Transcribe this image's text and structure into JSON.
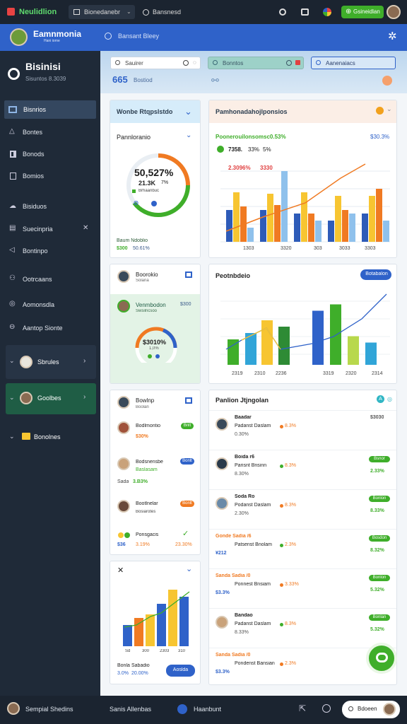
{
  "topbar": {
    "app_name": "Neulidlion",
    "tab1": "Bionedanebr",
    "tab2": "Bansnesd",
    "action_button": "Gsineidlan"
  },
  "header": {
    "brand": "Eamnmonia",
    "brand_sub": "Hani iorne",
    "search_placeholder": "Bansant Bleey"
  },
  "sidebar": {
    "title": "Bisinisi",
    "subtitle": "Sisuntos  8.3039",
    "items": [
      {
        "label": "Bisnrios"
      },
      {
        "label": "Bontes"
      },
      {
        "label": "Bonods"
      },
      {
        "label": "Bomios"
      },
      {
        "label": "Bisiduos"
      },
      {
        "label": "Suecinpria"
      },
      {
        "label": "Bontinpo"
      },
      {
        "label": "Ootrcaans"
      },
      {
        "label": "Aomonsdla"
      },
      {
        "label": "Aantop Sionte"
      }
    ],
    "profiles": [
      {
        "label": "Sbrules"
      },
      {
        "label": "Goolbes"
      },
      {
        "label": "Bonolnes"
      }
    ]
  },
  "filters": {
    "f1": "Sauirer",
    "f2": "Bonntos",
    "f3": "Aanenaiacs",
    "stat1": "665",
    "stat2": "Bostiod"
  },
  "cards": {
    "donut": {
      "title": "Wonbe Rtqpslstdo",
      "subtitle": "Pannloranio",
      "value": "50,527%",
      "sub1": "21.3K",
      "sub1_suffix": "7%",
      "sub2": "Brhaanbuc",
      "legend_label": "Baum Ndoblio",
      "legend_v1": "$300",
      "legend_v2": "50.61%"
    },
    "bar_main": {
      "title": "Pamhonadahojlponsios",
      "subtitle": "Poonerouilonsomsc0.53%",
      "right_value": "$30.3%",
      "l1a": "7358.",
      "l1b": "33%",
      "l1c": "5%",
      "l2a": "2.3096%",
      "l2b": "3330"
    },
    "profile_card": {
      "name": "Boorokio",
      "sub": "Solana",
      "name2": "Venmbodon",
      "sub2": "Swsilncsoo",
      "value": "$300",
      "gauge_value": "$3010%",
      "gauge_sub": "1,0%"
    },
    "bar_second": {
      "title": "Peotnbdeio",
      "button": "Botabalon"
    },
    "contacts": {
      "title": "Bowlnp",
      "subtitle": "Boolan",
      "rows": [
        {
          "name": "Bodlmontio",
          "value": "$30%",
          "tag": "Bnlt"
        },
        {
          "name": "Bodsnensbe",
          "value": "Baslasam",
          "tag": "Bonlt"
        },
        {
          "name": "Bootlnelar",
          "value": "Bosiarotes",
          "tag": "Bonlt"
        }
      ],
      "footer_a": "Ponsgacis",
      "footer_b": "$36",
      "footer_c": "3.19%",
      "footer_d": "23.30%",
      "footer_left": "Sada",
      "footer_left2": "3.B3%"
    },
    "list_card": {
      "title": "Panlion Jtjngolan",
      "rows": [
        {
          "top": "Baadar",
          "name": "Padanst Daslam",
          "pct": "8.3%",
          "val": "0.30%",
          "right": "$3030",
          "tag": ""
        },
        {
          "top": "Boida r6",
          "name": "Parisnt Bnsinn",
          "pct": "8.3%",
          "val": "8.30%",
          "right": "2.33%",
          "tag": "Bsnor"
        },
        {
          "top": "Soda Ro",
          "name": "Podanst Daslam",
          "pct": "8.3%",
          "val": "2.30%",
          "right": "8.33%",
          "tag": "Bonlon"
        },
        {
          "top": "Gonde Sadia /6",
          "name": "Patsenst Bnolam",
          "pct": "2.3%",
          "val": "¥212",
          "right": "8.32%",
          "tag": "Bosdon"
        },
        {
          "top": "Sanda Sadia /0",
          "name": "Ponnest Bnsiam",
          "pct": "3.33%",
          "val": "$3.3%",
          "right": "5.32%",
          "tag": "Bonlon"
        },
        {
          "top": "Bandao",
          "name": "Padanst Daslam",
          "pct": "8.3%",
          "val": "8.33%",
          "right": "5.32%",
          "tag": "Bonlan"
        },
        {
          "top": "Sanda Sadia /0",
          "name": "Pondenst Bansian",
          "pct": "2.3%",
          "val": "$3.3%",
          "right": "",
          "tag": ""
        }
      ]
    },
    "mini_chart": {
      "label1": "Bonla",
      "label2": "Sabadio",
      "value1": "3.0%",
      "value2": "20.00%",
      "button": "Aoslda"
    }
  },
  "bottombar": {
    "left": "Sempial Shedins",
    "middle": "Sanis  Allenbas",
    "right": "Haanbunt",
    "far_right": "Bdoeen"
  },
  "chart_data": [
    {
      "type": "bar",
      "name": "bar_main",
      "series": [
        {
          "color": "#2e5bb8",
          "values": [
            45,
            45,
            40,
            30,
            40
          ]
        },
        {
          "color": "#f7c531",
          "values": [
            70,
            68,
            70,
            65,
            65
          ]
        },
        {
          "color": "#f07a22",
          "values": [
            50,
            52,
            40,
            45,
            75
          ]
        },
        {
          "color": "#8fc1ec",
          "values": [
            20,
            100,
            30,
            40,
            30
          ]
        }
      ]
    },
    {
      "type": "bar",
      "name": "bar_second",
      "values": [
        40,
        50,
        70,
        60,
        85,
        95,
        45,
        35
      ]
    },
    {
      "type": "bar",
      "name": "mini_chart",
      "values": [
        30,
        40,
        45,
        60,
        80,
        70
      ]
    }
  ],
  "colors": {
    "primary": "#2f62c9",
    "green": "#3fae2a",
    "orange": "#f07a22",
    "yellow": "#f7c531",
    "dark": "#1f2a38"
  }
}
